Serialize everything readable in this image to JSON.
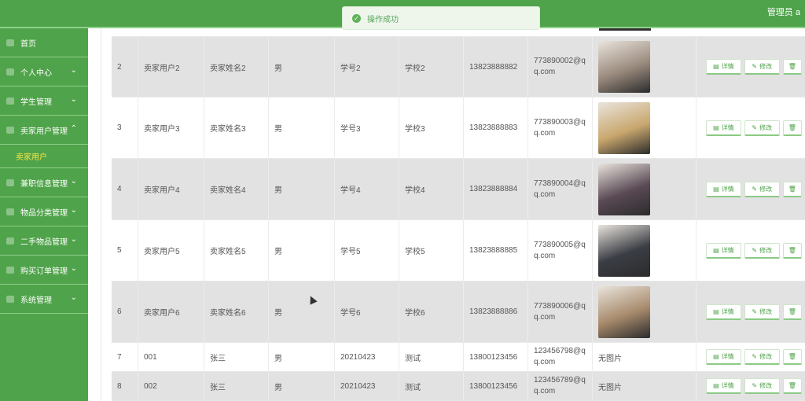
{
  "header": {
    "admin_label": "管理员 a"
  },
  "toast": {
    "message": "操作成功"
  },
  "sidebar": {
    "items": [
      {
        "label": "首页",
        "chevron": ""
      },
      {
        "label": "个人中心",
        "chevron": "⌄"
      },
      {
        "label": "学生管理",
        "chevron": "⌄"
      },
      {
        "label": "卖家用户管理",
        "chevron": "⌃"
      },
      {
        "label": "兼职信息管理",
        "chevron": "⌄"
      },
      {
        "label": "物品分类管理",
        "chevron": "⌄"
      },
      {
        "label": "二手物品管理",
        "chevron": "⌄"
      },
      {
        "label": "购买订单管理",
        "chevron": "⌄"
      },
      {
        "label": "系统管理",
        "chevron": "⌄"
      }
    ],
    "submenu": {
      "label": "卖家用户"
    }
  },
  "actions": {
    "detail": "详情",
    "edit": "修改",
    "delete_icon": "🗑"
  },
  "rows": [
    {
      "idx": "2",
      "account": "卖家用户2",
      "name": "卖家姓名2",
      "gender": "男",
      "sno": "学号2",
      "school": "学校2",
      "phone": "13823888882",
      "email": "773890002@qq.com",
      "photo": {
        "type": "img",
        "color": "#9a8a7d"
      },
      "alt": true
    },
    {
      "idx": "3",
      "account": "卖家用户3",
      "name": "卖家姓名3",
      "gender": "男",
      "sno": "学号3",
      "school": "学校3",
      "phone": "13823888883",
      "email": "773890003@qq.com",
      "photo": {
        "type": "img",
        "color": "#c9a76e"
      },
      "alt": false
    },
    {
      "idx": "4",
      "account": "卖家用户4",
      "name": "卖家姓名4",
      "gender": "男",
      "sno": "学号4",
      "school": "学校4",
      "phone": "13823888884",
      "email": "773890004@qq.com",
      "photo": {
        "type": "img",
        "color": "#5a4a55"
      },
      "alt": true
    },
    {
      "idx": "5",
      "account": "卖家用户5",
      "name": "卖家姓名5",
      "gender": "男",
      "sno": "学号5",
      "school": "学校5",
      "phone": "13823888885",
      "email": "773890005@qq.com",
      "photo": {
        "type": "img",
        "color": "#3a3d44"
      },
      "alt": false
    },
    {
      "idx": "6",
      "account": "卖家用户6",
      "name": "卖家姓名6",
      "gender": "男",
      "sno": "学号6",
      "school": "学校6",
      "phone": "13823888886",
      "email": "773890006@qq.com",
      "photo": {
        "type": "img",
        "color": "#a78a6c"
      },
      "alt": true
    },
    {
      "idx": "7",
      "account": "001",
      "name": "张三",
      "gender": "男",
      "sno": "20210423",
      "school": "测试",
      "phone": "13800123456",
      "email": "123456798@qq.com",
      "photo": {
        "type": "text",
        "text": "无图片"
      },
      "alt": false
    },
    {
      "idx": "8",
      "account": "002",
      "name": "张三",
      "gender": "男",
      "sno": "20210423",
      "school": "测试",
      "phone": "13800123456",
      "email": "123456789@qq.com",
      "photo": {
        "type": "text",
        "text": "无图片"
      },
      "alt": true
    }
  ]
}
